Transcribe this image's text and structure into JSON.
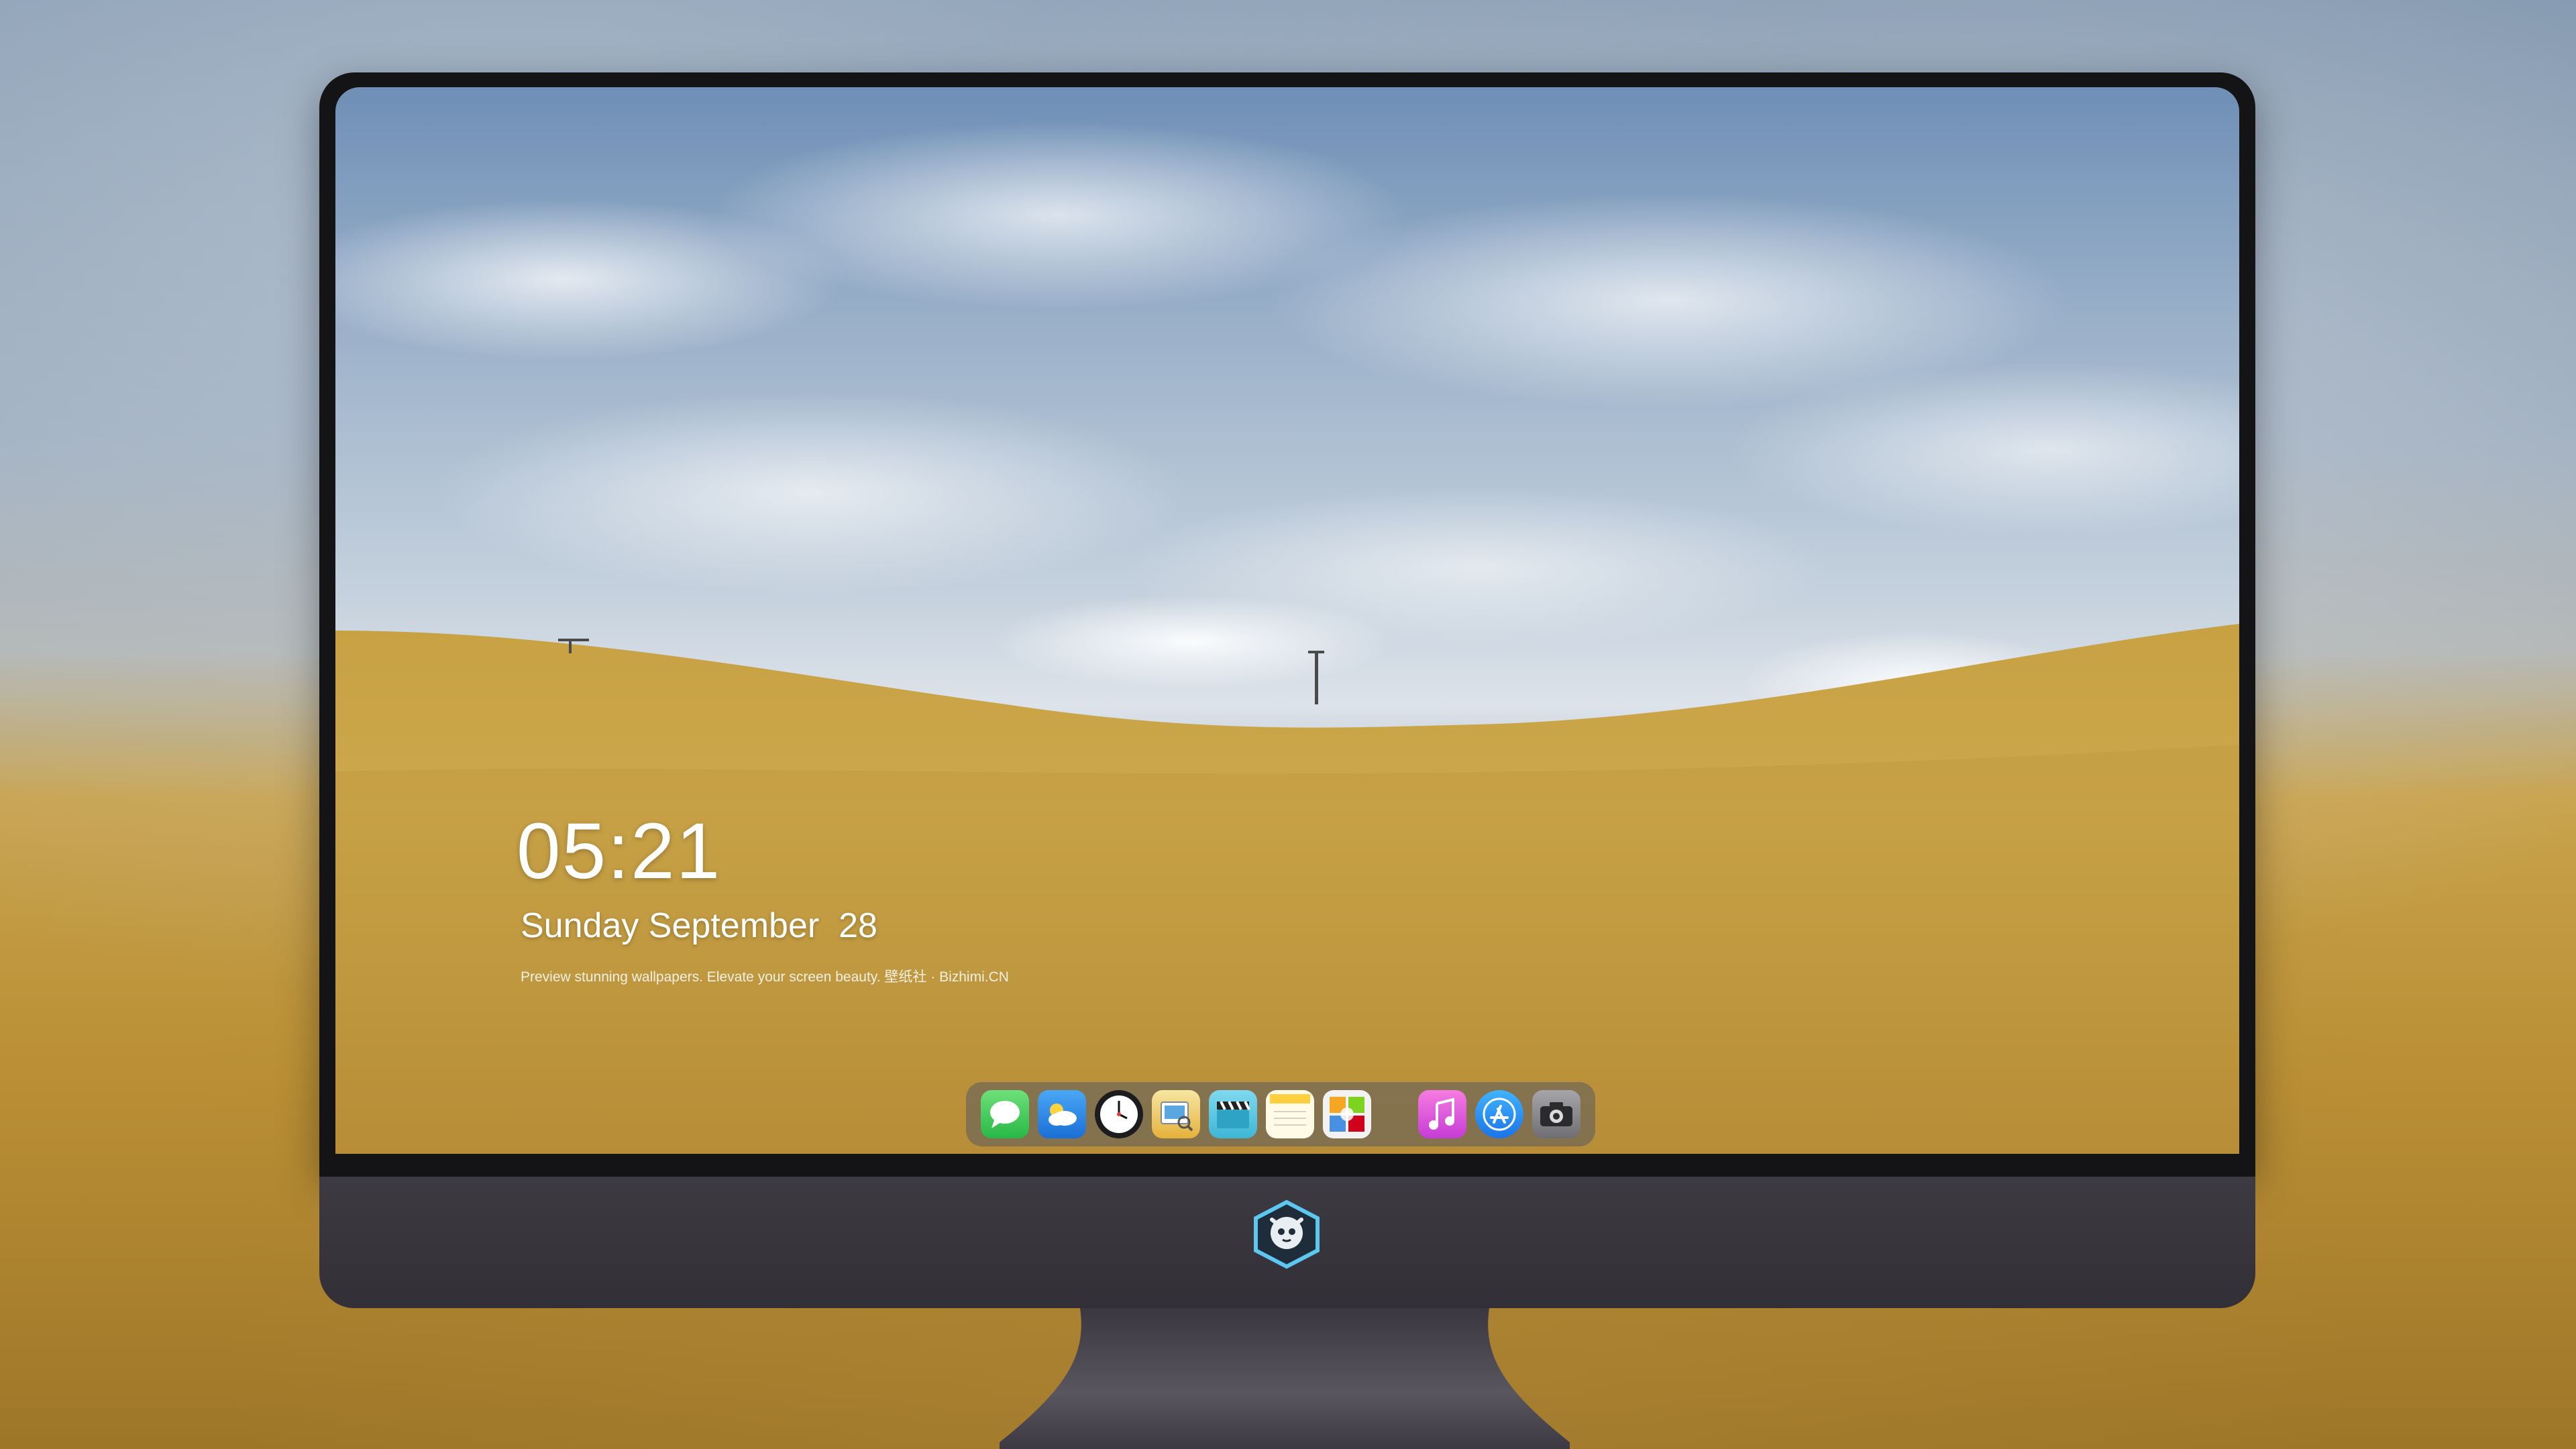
{
  "lock_screen": {
    "time": "05:21",
    "date": "Sunday September  28",
    "caption": "Preview stunning wallpapers. Elevate your screen beauty. 壁纸社 · Bizhimi.CN"
  },
  "dock": {
    "apps": [
      {
        "icon": "messages-icon",
        "color": "#34c759"
      },
      {
        "icon": "weather-icon",
        "color": "#2d8cf0"
      },
      {
        "icon": "clock-icon",
        "color": "#1c1c1e"
      },
      {
        "icon": "preview-icon",
        "color": "#f2c94c"
      },
      {
        "icon": "clapperboard-icon",
        "color": "#5ac8e6"
      },
      {
        "icon": "notes-icon",
        "color": "#ffd84a"
      },
      {
        "icon": "photo-booth-icon",
        "color": "#4aa3df"
      },
      {
        "icon": "music-icon",
        "color": "#ee4ccf"
      },
      {
        "icon": "app-store-icon",
        "color": "#1e90ff"
      },
      {
        "icon": "camera-icon",
        "color": "#8a8a8e"
      }
    ]
  }
}
